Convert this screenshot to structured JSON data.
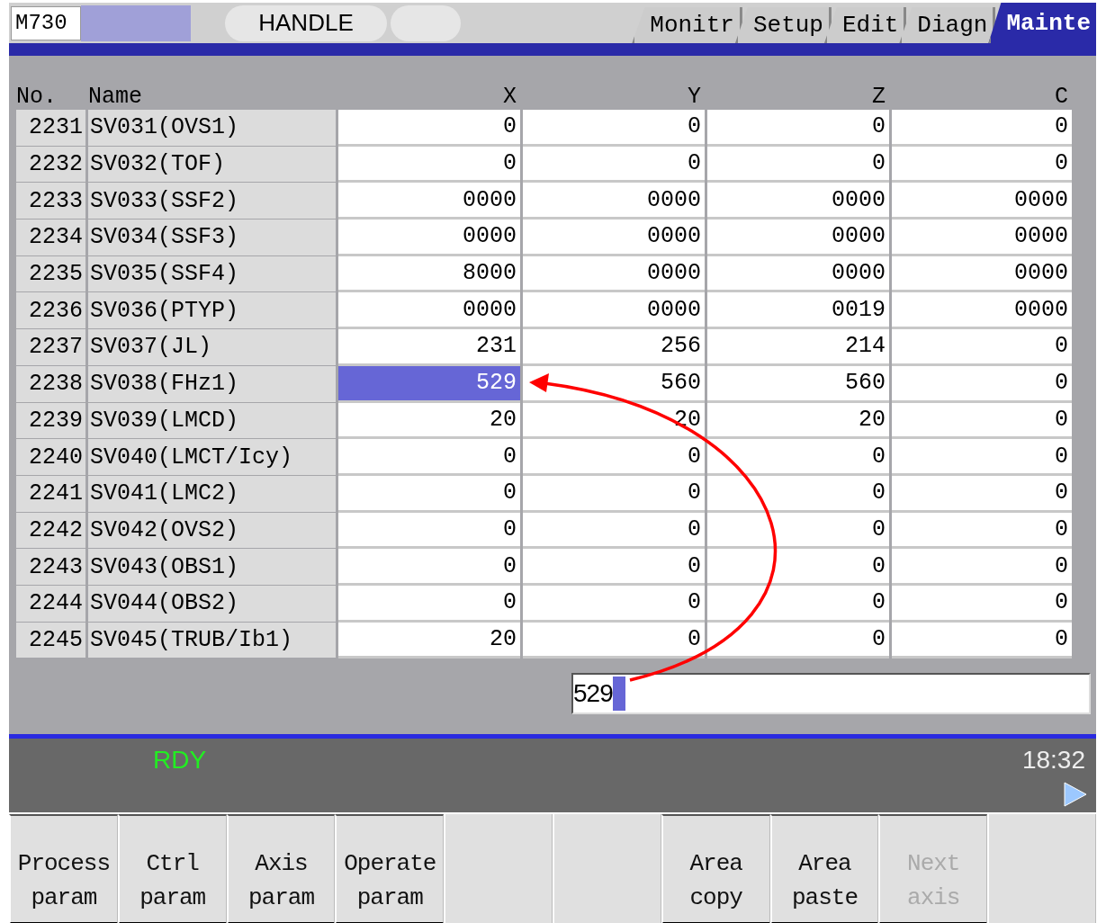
{
  "top_bar": {
    "model": "M730",
    "mode": "HANDLE"
  },
  "tabs": [
    {
      "label": "Monitr",
      "selected": false
    },
    {
      "label": "Setup",
      "selected": false
    },
    {
      "label": "Edit",
      "selected": false
    },
    {
      "label": "Diagn",
      "selected": false
    },
    {
      "label": "Mainte",
      "selected": true
    }
  ],
  "table": {
    "columns": [
      "No.",
      "Name",
      "X",
      "Y",
      "Z",
      "C"
    ],
    "rows": [
      {
        "cells": [
          {
            "value": "2231",
            "selected": false
          },
          {
            "value": "SV031(OVS1)",
            "selected": false
          },
          {
            "value": "0",
            "selected": false
          },
          {
            "value": "0",
            "selected": false
          },
          {
            "value": "0",
            "selected": false
          },
          {
            "value": "0",
            "selected": false
          }
        ]
      },
      {
        "cells": [
          {
            "value": "2232",
            "selected": false
          },
          {
            "value": "SV032(TOF)",
            "selected": false
          },
          {
            "value": "0",
            "selected": false
          },
          {
            "value": "0",
            "selected": false
          },
          {
            "value": "0",
            "selected": false
          },
          {
            "value": "0",
            "selected": false
          }
        ]
      },
      {
        "cells": [
          {
            "value": "2233",
            "selected": false
          },
          {
            "value": "SV033(SSF2)",
            "selected": false
          },
          {
            "value": "0000",
            "selected": false
          },
          {
            "value": "0000",
            "selected": false
          },
          {
            "value": "0000",
            "selected": false
          },
          {
            "value": "0000",
            "selected": false
          }
        ]
      },
      {
        "cells": [
          {
            "value": "2234",
            "selected": false
          },
          {
            "value": "SV034(SSF3)",
            "selected": false
          },
          {
            "value": "0000",
            "selected": false
          },
          {
            "value": "0000",
            "selected": false
          },
          {
            "value": "0000",
            "selected": false
          },
          {
            "value": "0000",
            "selected": false
          }
        ]
      },
      {
        "cells": [
          {
            "value": "2235",
            "selected": false
          },
          {
            "value": "SV035(SSF4)",
            "selected": false
          },
          {
            "value": "8000",
            "selected": false
          },
          {
            "value": "0000",
            "selected": false
          },
          {
            "value": "0000",
            "selected": false
          },
          {
            "value": "0000",
            "selected": false
          }
        ]
      },
      {
        "cells": [
          {
            "value": "2236",
            "selected": false
          },
          {
            "value": "SV036(PTYP)",
            "selected": false
          },
          {
            "value": "0000",
            "selected": false
          },
          {
            "value": "0000",
            "selected": false
          },
          {
            "value": "0019",
            "selected": false
          },
          {
            "value": "0000",
            "selected": false
          }
        ]
      },
      {
        "cells": [
          {
            "value": "2237",
            "selected": false
          },
          {
            "value": "SV037(JL)",
            "selected": false
          },
          {
            "value": "231",
            "selected": false
          },
          {
            "value": "256",
            "selected": false
          },
          {
            "value": "214",
            "selected": false
          },
          {
            "value": "0",
            "selected": false
          }
        ]
      },
      {
        "cells": [
          {
            "value": "2238",
            "selected": false
          },
          {
            "value": "SV038(FHz1)",
            "selected": false
          },
          {
            "value": "529",
            "selected": true
          },
          {
            "value": "560",
            "selected": false
          },
          {
            "value": "560",
            "selected": false
          },
          {
            "value": "0",
            "selected": false
          }
        ]
      },
      {
        "cells": [
          {
            "value": "2239",
            "selected": false
          },
          {
            "value": "SV039(LMCD)",
            "selected": false
          },
          {
            "value": "20",
            "selected": false
          },
          {
            "value": "20",
            "selected": false
          },
          {
            "value": "20",
            "selected": false
          },
          {
            "value": "0",
            "selected": false
          }
        ]
      },
      {
        "cells": [
          {
            "value": "2240",
            "selected": false
          },
          {
            "value": "SV040(LMCT/Icy)",
            "selected": false
          },
          {
            "value": "0",
            "selected": false
          },
          {
            "value": "0",
            "selected": false
          },
          {
            "value": "0",
            "selected": false
          },
          {
            "value": "0",
            "selected": false
          }
        ]
      },
      {
        "cells": [
          {
            "value": "2241",
            "selected": false
          },
          {
            "value": "SV041(LMC2)",
            "selected": false
          },
          {
            "value": "0",
            "selected": false
          },
          {
            "value": "0",
            "selected": false
          },
          {
            "value": "0",
            "selected": false
          },
          {
            "value": "0",
            "selected": false
          }
        ]
      },
      {
        "cells": [
          {
            "value": "2242",
            "selected": false
          },
          {
            "value": "SV042(OVS2)",
            "selected": false
          },
          {
            "value": "0",
            "selected": false
          },
          {
            "value": "0",
            "selected": false
          },
          {
            "value": "0",
            "selected": false
          },
          {
            "value": "0",
            "selected": false
          }
        ]
      },
      {
        "cells": [
          {
            "value": "2243",
            "selected": false
          },
          {
            "value": "SV043(OBS1)",
            "selected": false
          },
          {
            "value": "0",
            "selected": false
          },
          {
            "value": "0",
            "selected": false
          },
          {
            "value": "0",
            "selected": false
          },
          {
            "value": "0",
            "selected": false
          }
        ]
      },
      {
        "cells": [
          {
            "value": "2244",
            "selected": false
          },
          {
            "value": "SV044(OBS2)",
            "selected": false
          },
          {
            "value": "0",
            "selected": false
          },
          {
            "value": "0",
            "selected": false
          },
          {
            "value": "0",
            "selected": false
          },
          {
            "value": "0",
            "selected": false
          }
        ]
      },
      {
        "cells": [
          {
            "value": "2245",
            "selected": false
          },
          {
            "value": "SV045(TRUB/Ib1)",
            "selected": false
          },
          {
            "value": "20",
            "selected": false
          },
          {
            "value": "0",
            "selected": false
          },
          {
            "value": "0",
            "selected": false
          },
          {
            "value": "0",
            "selected": false
          }
        ]
      }
    ]
  },
  "input": {
    "value": "529"
  },
  "status_bar": {
    "state": "RDY",
    "time": "18:32"
  },
  "softkeys": [
    {
      "kind": "key",
      "lines": [
        "Process",
        "param"
      ],
      "disabled": false
    },
    {
      "kind": "key",
      "lines": [
        "Ctrl",
        "param"
      ],
      "disabled": false
    },
    {
      "kind": "key",
      "lines": [
        "Axis",
        "param"
      ],
      "disabled": false
    },
    {
      "kind": "key",
      "lines": [
        "Operate",
        "param"
      ],
      "disabled": false
    },
    {
      "kind": "blank"
    },
    {
      "kind": "blank"
    },
    {
      "kind": "key",
      "lines": [
        "Area",
        "copy"
      ],
      "disabled": false
    },
    {
      "kind": "key",
      "lines": [
        "Area",
        "paste"
      ],
      "disabled": false
    },
    {
      "kind": "key",
      "lines": [
        "Next",
        "axis"
      ],
      "disabled": true
    },
    {
      "kind": "blank"
    }
  ]
}
